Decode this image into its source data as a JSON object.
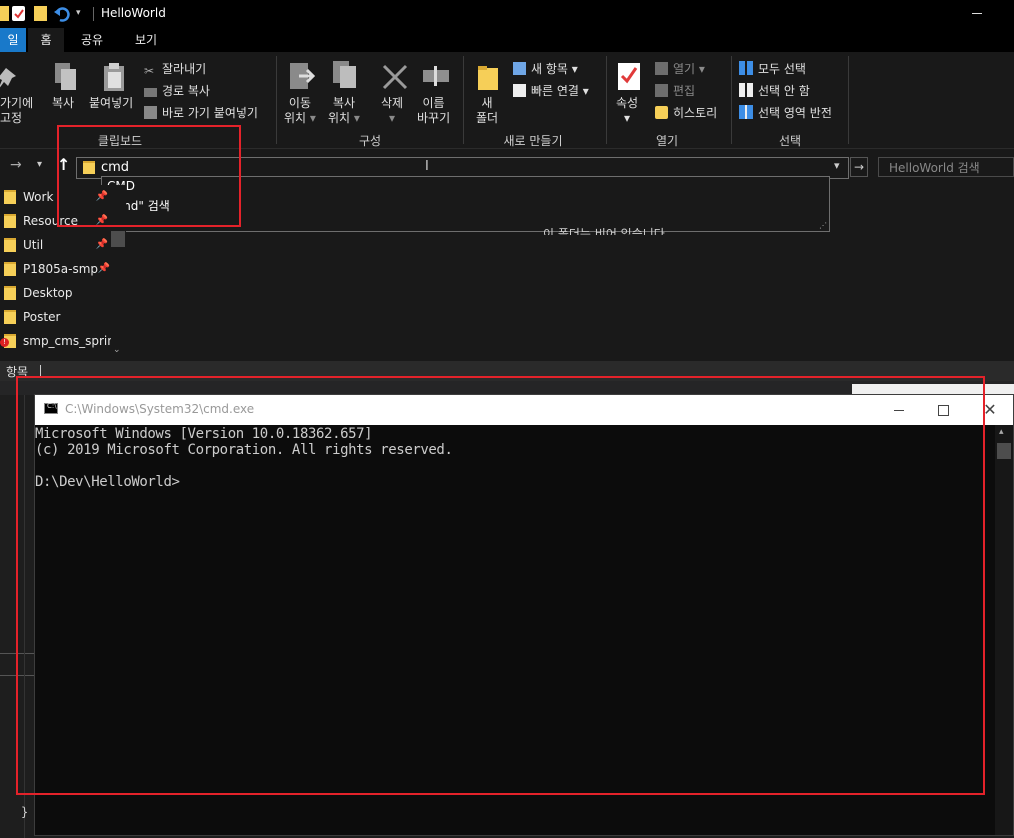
{
  "window": {
    "title": "HelloWorld"
  },
  "tabs": [
    "일",
    "홈",
    "공유",
    "보기"
  ],
  "ribbon": {
    "clipboard": {
      "group_label": "클립보드",
      "pin_label_1": "가기에",
      "pin_label_2": "고정",
      "copy": "복사",
      "paste": "붙여넣기",
      "cut": "잘라내기",
      "copy_path": "경로 복사",
      "paste_shortcut": "바로 가기 붙여넣기"
    },
    "organize": {
      "group_label": "구성",
      "move_to_1": "이동",
      "move_to_2": "위치",
      "copy_to_1": "복사",
      "copy_to_2": "위치",
      "delete": "삭제",
      "rename_1": "이름",
      "rename_2": "바꾸기"
    },
    "new": {
      "group_label": "새로 만들기",
      "new_folder_1": "새",
      "new_folder_2": "폴더",
      "new_item": "새 항목",
      "easy_access": "빠른 연결"
    },
    "open": {
      "group_label": "열기",
      "properties": "속성",
      "open": "열기",
      "edit": "편집",
      "history": "히스토리"
    },
    "select": {
      "group_label": "선택",
      "select_all": "모두 선택",
      "select_none": "선택 안 함",
      "invert": "선택 영역 반전"
    }
  },
  "address": {
    "value": "cmd",
    "search_placeholder": "HelloWorld 검색",
    "suggestions": [
      "CMD",
      "\"cmd\" 검색"
    ]
  },
  "content": {
    "empty_message": "이 폴더는 비어 있습니다."
  },
  "nav": {
    "items": [
      {
        "label": "Work",
        "pinned": true
      },
      {
        "label": "Resource",
        "pinned": true
      },
      {
        "label": "Util",
        "pinned": true
      },
      {
        "label": "P1805a-smp",
        "pinned": true
      },
      {
        "label": "Desktop",
        "pinned": false
      },
      {
        "label": "Poster",
        "pinned": false
      },
      {
        "label": "smp_cms_sprint",
        "pinned": false
      }
    ]
  },
  "statusbar": {
    "text": "항목"
  },
  "cmd": {
    "title": "C:\\Windows\\System32\\cmd.exe",
    "lines": [
      "Microsoft Windows [Version 10.0.18362.657]",
      "(c) 2019 Microsoft Corporation. All rights reserved.",
      "",
      "D:\\Dev\\HelloWorld>"
    ]
  },
  "colors": {
    "accent": "#1979ca",
    "highlight": "#e4222a",
    "folder": "#f6cf58"
  }
}
